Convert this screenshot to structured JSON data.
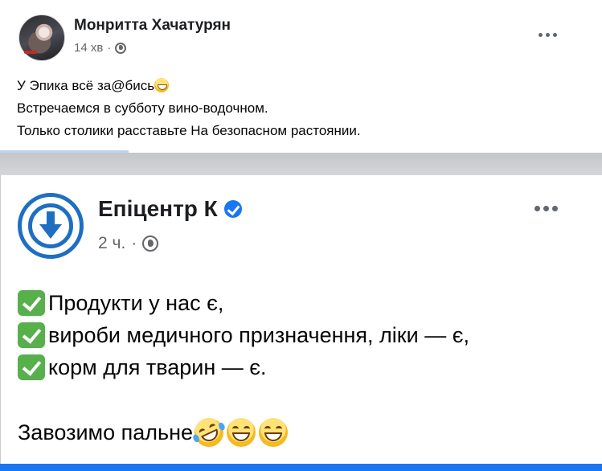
{
  "post1": {
    "author": "Монритта Хачатурян",
    "time": "14 хв",
    "separator": "·",
    "lines": [
      "У Эпика  всё за@бись",
      "Встречаемся в субботу  вино-водочном.",
      "Только столики  расставьте На безопасном растоянии."
    ]
  },
  "post2": {
    "author": "Епіцентр К",
    "time": "2 ч.",
    "separator": "·",
    "lines": [
      "Продукти у нас є,",
      "вироби медичного призначення, ліки — є,",
      "корм для тварин — є."
    ],
    "final": "Завозимо пальне"
  },
  "icons": {
    "globe": "globe-icon",
    "more": "more-options-icon",
    "verified": "verified-badge-icon",
    "check": "check-mark-icon",
    "emoji_grin": "grinning-emoji-icon",
    "emoji_rofl": "rofl-emoji-icon",
    "emoji_smile": "smiling-emoji-icon"
  },
  "colors": {
    "brand_blue": "#1877f2",
    "logo_blue": "#1e6fc2",
    "check_green": "#57b04c",
    "meta_gray": "#65676b"
  }
}
